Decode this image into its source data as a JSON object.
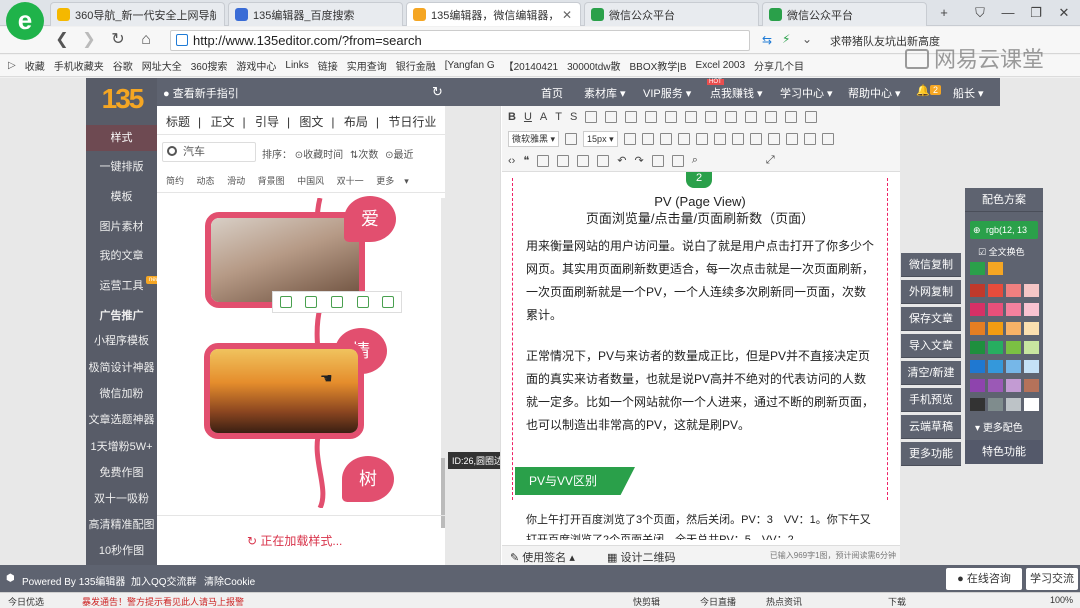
{
  "browser": {
    "tabs": [
      {
        "label": "360导航_新一代安全上网导航",
        "favicon_color": "#f5b800"
      },
      {
        "label": "135编辑器_百度搜索",
        "favicon_color": "#3a6cd6"
      },
      {
        "label": "135编辑器，微信编辑器，微信",
        "favicon_color": "#f5a623"
      },
      {
        "label": "微信公众平台",
        "favicon_color": "#2aa04a"
      },
      {
        "label": "微信公众平台",
        "favicon_color": "#2aa04a"
      }
    ],
    "url": "http://www.135editor.com/?from=search",
    "addr_right_text": "求带猪队友坑出新高度",
    "watermark": "网易云课堂",
    "bookmarks": [
      "收藏",
      "手机收藏夹",
      "谷歌",
      "网址大全",
      "360搜索",
      "游戏中心",
      "Links",
      "链接",
      "实用查询",
      "银行金融",
      "[Yangfan G",
      "【20140421",
      "30000tdw散",
      "BBOX教学|B",
      "Excel 2003",
      "分享几个目"
    ]
  },
  "site": {
    "guide_link": "查看新手指引",
    "top_nav": [
      "首页",
      "素材库",
      "VIP服务",
      "点我赚钱",
      "学习中心",
      "帮助中心",
      "船长"
    ],
    "hot_badge": "HOT",
    "notify_count": "2",
    "left_nav": [
      {
        "label": "样式",
        "active": true
      },
      {
        "label": "一键排版"
      },
      {
        "label": "模板"
      },
      {
        "label": "图片素材"
      },
      {
        "label": "我的文章"
      },
      {
        "label": "运营工具"
      },
      {
        "label": "广告推广"
      },
      {
        "label": "小程序模板"
      },
      {
        "label": "极简设计神器"
      },
      {
        "label": "微信加粉"
      },
      {
        "label": "文章选题神器"
      },
      {
        "label": "1天增粉5W+"
      },
      {
        "label": "免费作图"
      },
      {
        "label": "双十一吸粉"
      },
      {
        "label": "高清精准配图"
      },
      {
        "label": "10秒作图"
      }
    ],
    "new_badge": "new"
  },
  "style_panel": {
    "categories": [
      "标题",
      "正文",
      "引导",
      "图文",
      "布局",
      "节日行业"
    ],
    "search_value": "汽车",
    "sort_label": "排序：",
    "sort_options": [
      "收藏时间",
      "次数",
      "最近"
    ],
    "tags": [
      "简约",
      "动态",
      "滑动",
      "背景图",
      "中国风",
      "双十一",
      "更多"
    ],
    "template_chars": [
      "爱",
      "情",
      "树"
    ],
    "tooltip": "ID:26,圆圈边框组合样式",
    "loading_text": "正在加载样式..."
  },
  "editor": {
    "font_family": "微软雅黑",
    "font_size": "15px",
    "section_number": "2",
    "title_line1": "PV (Page View)",
    "title_line2": "页面浏览量/点击量/页面刷新数（页面）",
    "paragraphs": [
      "用来衡量网站的用户访问量。说白了就是用户点击打开了你多少个网页。其实用页面刷新数更适合，每一次点击就是一次页面刷新，一次页面刷新就是一个PV，一个人连续多次刷新同一页面，次数累计。",
      "正常情况下，PV与来访者的数量成正比，但是PV并不直接决定页面的真实来访者数量，也就是说PV高并不绝对的代表访问的人数就一定多。比如一个网站就你一个人进来，通过不断的刷新页面，也可以制造出非常高的PV，这就是刷PV。"
    ],
    "section_tag": "PV与VV区别",
    "last_paragraph": "你上午打开百度浏览了3个页面，然后关闭。PV：3　VV：1。你下午又打开百度浏览了2个页面关闭，全天总共PV：5　VV：2",
    "footer_left": "使用签名",
    "footer_mid": "设计二维码",
    "footer_count": "已输入969字1图，预计阅读需6分钟"
  },
  "right_actions": [
    "微信复制",
    "外网复制",
    "保存文章",
    "导入文章",
    "清空/新建",
    "手机预览",
    "云端草稿",
    "更多功能"
  ],
  "color_panel": {
    "title": "配色方案",
    "input_value": "rgb(12, 13",
    "fullcolor_label": "全文换色",
    "more_label": "更多配色",
    "feature_label": "特色功能",
    "top_swatches": [
      "#2aa04a",
      "#f5a623"
    ],
    "swatches": [
      "#c0392b",
      "#e74c3c",
      "#f08080",
      "#f5c6c6",
      "#d63066",
      "#e8507a",
      "#f4819e",
      "#f9c3d1",
      "#e67e22",
      "#f39c12",
      "#f7b267",
      "#fbe0b0",
      "#1e8f3e",
      "#27ae60",
      "#7bc043",
      "#c8e6a0",
      "#1f78d1",
      "#3498db",
      "#76b7e8",
      "#c4e1f7",
      "#8e44ad",
      "#9b59b6",
      "#c39bd3",
      "#b5725a",
      "#333333",
      "#7f8c8d",
      "#bdc3c7",
      "#ffffff"
    ]
  },
  "site_footer": {
    "powered": "Powered By 135编辑器",
    "qq_group": "加入QQ交流群",
    "clear_cookie": "清除Cookie",
    "online_consult": "在线咨询",
    "study": "学习交流"
  },
  "statusbar": {
    "left1": "今日优选",
    "left2": "暴发通告！警方提示看见此人请马上报警",
    "items": [
      "快剪辑",
      "今日直播",
      "热点资讯",
      "下载",
      "100%"
    ]
  }
}
